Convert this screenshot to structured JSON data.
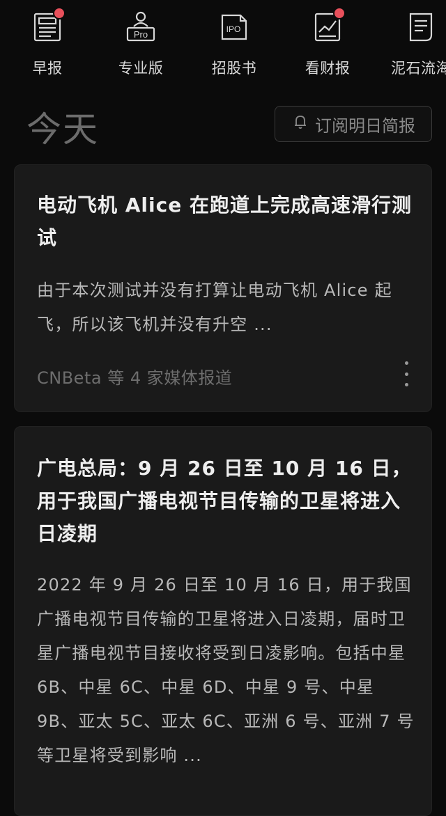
{
  "nav": {
    "items": [
      {
        "label": "早报",
        "icon": "newspaper-icon",
        "badge": true
      },
      {
        "label": "专业版",
        "icon": "pro-user-icon",
        "badge": false
      },
      {
        "label": "招股书",
        "icon": "ipo-doc-icon",
        "badge": false
      },
      {
        "label": "看财报",
        "icon": "report-chart-icon",
        "badge": true
      },
      {
        "label": "泥石流海",
        "icon": "document-list-icon",
        "badge": false
      }
    ],
    "pro_badge": "Pro",
    "ipo_badge": "IPO"
  },
  "section": {
    "title": "今天",
    "subscribe_label": "订阅明日简报"
  },
  "articles": [
    {
      "title": "电动飞机 Alice 在跑道上完成高速滑行测试",
      "summary": "由于本次测试并没有打算让电动飞机 Alice 起飞，所以该飞机并没有升空 ...",
      "source": "CNBeta 等 4 家媒体报道"
    },
    {
      "title": "广电总局：9 月 26 日至 10 月 16 日，用于我国广播电视节目传输的卫星将进入日凌期",
      "summary": "2022 年 9 月 26 日至 10 月 16 日，用于我国广播电视节目传输的卫星将进入日凌期，届时卫星广播电视节目接收将受到日凌影响。包括中星 6B、中星 6C、中星 6D、中星 9 号、中星 9B、亚太 5C、亚太 6C、亚洲 6 号、亚洲 7 号等卫星将受到影响 ..."
    }
  ],
  "colors": {
    "background": "#0b0b0b",
    "card": "#1a1a1a",
    "badge": "#e8505b"
  }
}
